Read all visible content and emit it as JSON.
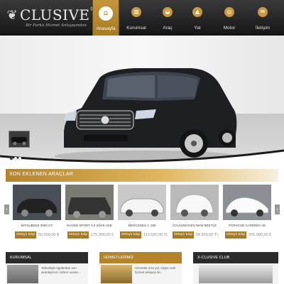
{
  "brand": {
    "name": "CLUSIVE",
    "registered_mark": "®",
    "tagline": "Bir Farklı Hizmet Anlayışından",
    "emblem_icon": "winged-emblem-icon"
  },
  "colors": {
    "accent": "#b4842a",
    "header_dark": "#1c1c1c",
    "light_gray": "#eeeeee"
  },
  "nav": {
    "items": [
      {
        "label": "Anasayfa",
        "icon": "home-icon",
        "glyph": "⌂",
        "active": true
      },
      {
        "label": "Kurumsal",
        "icon": "building-icon",
        "glyph": "▥",
        "active": false
      },
      {
        "label": "Araç",
        "icon": "car-icon",
        "glyph": "◒",
        "active": false
      },
      {
        "label": "Yat",
        "icon": "boat-icon",
        "glyph": "▲",
        "active": false
      },
      {
        "label": "Motor",
        "icon": "motorcycle-icon",
        "glyph": "◎",
        "active": false
      },
      {
        "label": "İletişim",
        "icon": "contact-icon",
        "glyph": "✉",
        "active": false
      }
    ]
  },
  "hero": {
    "car_badge": "CLUSIVE",
    "slider_dots": 3,
    "active_dot": 0
  },
  "products": {
    "section_title": "SON EKLENEN ARAÇLAR",
    "prev_icon": "chevron-left-icon",
    "next_icon": "chevron-right-icon",
    "cards": [
      {
        "name": "MITSUBISHI 3000 GT",
        "button": "detaylı bilgi",
        "price": "50.000,00 $",
        "color": "#2a2a2a"
      },
      {
        "name": "RANGE SPORT 3.0 SDV6 HSE",
        "button": "detaylı bilgi",
        "price": "175.000,00 €",
        "color": "#3a3a3a"
      },
      {
        "name": "MERCEDES C 180",
        "button": "detaylı bilgi",
        "price": "112.500,00 TL",
        "color": "#f2f2f2"
      },
      {
        "name": "VOLKSWAGEN NEW BEETLE",
        "button": "detaylı bilgi",
        "price": "58.500,00 TL",
        "color": "#f6f6f6"
      },
      {
        "name": "PORSCHE CARRERA 4S",
        "button": "detaylı bilgi",
        "price": "265.000,00 €",
        "color": "#fafafa"
      }
    ]
  },
  "bottom_boxes": [
    {
      "title": "KURUMSAL",
      "head_color": "#2b2b2b",
      "text": "Teknolojin ögelerdan sen avantajımızı sizlere sunan..."
    },
    {
      "title": "HİZMETLERİMİZ",
      "head_color": "#b4842a",
      "text": "Hizmette size yol, kişiye özel hizmet anlayışı ile..."
    },
    {
      "title": "X-CLUSIVE CLUB",
      "head_color": "#2b2b2b",
      "text": ""
    }
  ]
}
